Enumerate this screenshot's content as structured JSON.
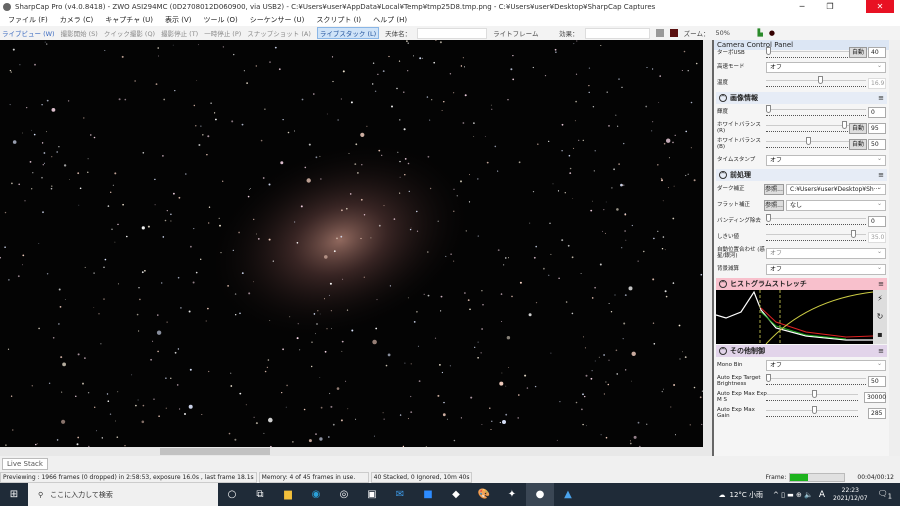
{
  "window": {
    "title": "SharpCap Pro (v4.0.8418) - ZWO ASI294MC (0D2708012D060900, via USB2) - C:¥Users¥user¥AppData¥Local¥Temp¥tmp25D8.tmp.png - C:¥Users¥user¥Desktop¥SharpCap Captures",
    "minimize": "─",
    "maximize": "❐",
    "close": "✕"
  },
  "menu": [
    "ファイル (F)",
    "カメラ (C)",
    "キャプチャ (U)",
    "表示 (V)",
    "ツール (O)",
    "シーケンサー (U)",
    "スクリプト (I)",
    "ヘルプ (H)"
  ],
  "toolbar": {
    "live_view": "ライブビュー (W)",
    "start_capture": "撮影開始 (S)",
    "quick_capture": "クイック撮影 (Q)",
    "stop_capture": "撮影停止 (T)",
    "pause": "一時停止 (P)",
    "snapshot": "スナップショット (A)",
    "live_stack": "ライブスタック (L)",
    "target_label": "天体名：",
    "frame_type": "ライトフレーム",
    "effect_label": "効果：",
    "zoom_label": "ズーム：",
    "zoom_value": "50%"
  },
  "panel": {
    "title": "Camera Control Panel",
    "top_rows": [
      {
        "label": "ターボUSB",
        "auto": "自動",
        "value": "40"
      },
      {
        "label": "高速モード",
        "select": "オフ"
      },
      {
        "label": "温度",
        "value": "16.9"
      }
    ],
    "image_info": {
      "title": "画像情報",
      "brightness": {
        "label": "輝度",
        "value": "0"
      },
      "wb_r": {
        "label": "ホワイトバランス(R)",
        "auto": "自動",
        "value": "95"
      },
      "wb_b": {
        "label": "ホワイトバランス(B)",
        "auto": "自動",
        "value": "50"
      },
      "timestamp": {
        "label": "タイムスタンプ",
        "select": "オフ"
      }
    },
    "preprocess": {
      "title": "前処理",
      "dark": {
        "label": "ダーク補正",
        "browse": "参照...",
        "select": "C:¥Users¥user¥Desktop¥Sh···"
      },
      "flat": {
        "label": "フラット補正",
        "browse": "参照...",
        "select": "なし"
      },
      "banding": {
        "label": "バンディング除去",
        "value": "0"
      },
      "threshold": {
        "label": "しきい値",
        "value": "35.0"
      },
      "auto_align": {
        "label": "自動位置合わせ (惑星/銀河)",
        "select": "オフ"
      },
      "bg_sub": {
        "label": "背景減算",
        "select": "オフ"
      }
    },
    "histogram": {
      "title": "ヒストグラムストレッチ"
    },
    "misc": {
      "title": "その他制御",
      "mono_bin": {
        "label": "Mono Bin",
        "select": "オフ"
      },
      "ae_target": {
        "label": "Auto Exp Target Brightness",
        "value": "50"
      },
      "ae_max_exp": {
        "label": "Auto Exp Max Exp M S",
        "value": "30000"
      },
      "ae_max_gain": {
        "label": "Auto Exp Max Gain",
        "value": "285"
      }
    }
  },
  "live_tab": "Live Stack",
  "status": {
    "preview": "Previewing : 1966 frames (0 dropped) in 2:58:53, exposure 16.0s , last frame 18.1s",
    "memory": "Memory: 4 of 45 frames in use.",
    "stacked": "40 Stacked, 0 Ignored, 10m 40s",
    "frame_label": "Frame:",
    "frame_progress": 0.33,
    "frame_time": "00:04/00:12"
  },
  "taskbar": {
    "search": "ここに入力して検索",
    "weather": "12°C 小雨",
    "ime": "A",
    "time": "22:23",
    "date": "2021/12/07",
    "notif": "1"
  },
  "colors": {
    "accent": "#3a6ac0",
    "hist_header": "#f8c0cc",
    "misc_header": "#e2d4ea",
    "close": "#e81123"
  }
}
